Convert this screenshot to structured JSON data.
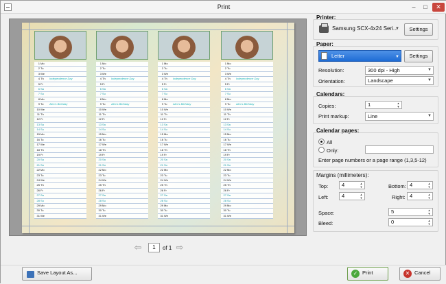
{
  "window": {
    "title": "Print",
    "min_icon": "minimize-icon",
    "max_icon": "maximize-icon",
    "close_icon": "close-icon"
  },
  "preview": {
    "columns": [
      {
        "photo": "photo-woman-icon",
        "events": [
          {
            "day": "4",
            "text": "Independence Day"
          },
          {
            "day": "9",
            "text": "Alex's Birthday"
          }
        ]
      },
      {
        "photo": "photo-girl-icon",
        "events": [
          {
            "day": "4",
            "text": "Independence Day"
          },
          {
            "day": "9",
            "text": "Alex's Birthday"
          }
        ]
      },
      {
        "photo": "photo-man-icon",
        "events": [
          {
            "day": "4",
            "text": "Independence Day"
          },
          {
            "day": "9",
            "text": "Alex's Birthday"
          }
        ]
      },
      {
        "photo": "photo-boy-icon",
        "events": [
          {
            "day": "4",
            "text": "Independence Day"
          },
          {
            "day": "9",
            "text": "Alex's Birthday"
          }
        ]
      }
    ],
    "days": [
      {
        "n": "1",
        "w": "Mo"
      },
      {
        "n": "2",
        "w": "Tu"
      },
      {
        "n": "3",
        "w": "We"
      },
      {
        "n": "4",
        "w": "Th"
      },
      {
        "n": "5",
        "w": "Fr"
      },
      {
        "n": "6",
        "w": "Sa"
      },
      {
        "n": "7",
        "w": "Su"
      },
      {
        "n": "8",
        "w": "Mo"
      },
      {
        "n": "9",
        "w": "Tu"
      },
      {
        "n": "10",
        "w": "We"
      },
      {
        "n": "11",
        "w": "Th"
      },
      {
        "n": "12",
        "w": "Fr"
      },
      {
        "n": "13",
        "w": "Sa"
      },
      {
        "n": "14",
        "w": "Su"
      },
      {
        "n": "15",
        "w": "Mo"
      },
      {
        "n": "16",
        "w": "Tu"
      },
      {
        "n": "17",
        "w": "We"
      },
      {
        "n": "18",
        "w": "Th"
      },
      {
        "n": "19",
        "w": "Fr"
      },
      {
        "n": "20",
        "w": "Sa"
      },
      {
        "n": "21",
        "w": "Su"
      },
      {
        "n": "22",
        "w": "Mo"
      },
      {
        "n": "23",
        "w": "Tu"
      },
      {
        "n": "24",
        "w": "We"
      },
      {
        "n": "25",
        "w": "Th"
      },
      {
        "n": "26",
        "w": "Fr"
      },
      {
        "n": "27",
        "w": "Sa"
      },
      {
        "n": "28",
        "w": "Su"
      },
      {
        "n": "29",
        "w": "Mo"
      },
      {
        "n": "30",
        "w": "Tu"
      },
      {
        "n": "31",
        "w": "We"
      }
    ]
  },
  "pager": {
    "current": "1",
    "of_label": "of 1",
    "prev_icon": "arrow-left-icon",
    "next_icon": "arrow-right-icon"
  },
  "printer": {
    "section": "Printer:",
    "value": "Samsung SCX-4x24 Seri...",
    "settings": "Settings"
  },
  "paper": {
    "section": "Paper:",
    "value": "Letter",
    "settings": "Settings",
    "resolution_label": "Resolution:",
    "resolution": "300 dpi - High",
    "orientation_label": "Orientation:",
    "orientation": "Landscape"
  },
  "calendars": {
    "section": "Calendars:",
    "copies_label": "Copies:",
    "copies": "1",
    "markup_label": "Print markup:",
    "markup": "Line"
  },
  "pages": {
    "section": "Calendar pages:",
    "all": "All",
    "only": "Only:",
    "only_value": "",
    "hint": "Enter page numbers or a page range (1,3,5-12)"
  },
  "margins": {
    "section": "Margins (millimeters):",
    "top_label": "Top:",
    "top": "4",
    "bottom_label": "Bottom:",
    "bottom": "4",
    "left_label": "Left:",
    "left": "4",
    "right_label": "Right:",
    "right": "4",
    "space_label": "Space:",
    "space": "5",
    "bleed_label": "Bleed:",
    "bleed": "0"
  },
  "footer": {
    "save": "Save Layout As...",
    "print": "Print",
    "cancel": "Cancel"
  },
  "colors": {
    "accent": "#1e6cd5",
    "weekend": "#1598a8",
    "event": "#17b2b8",
    "grid": "#b7c9df"
  }
}
